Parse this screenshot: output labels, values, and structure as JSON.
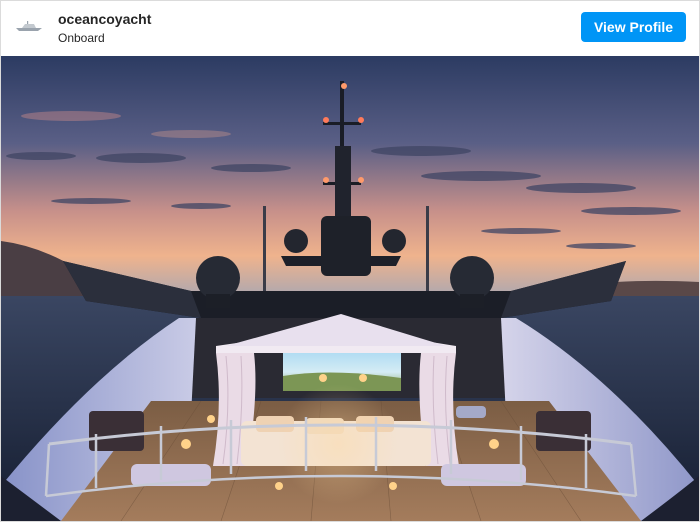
{
  "post": {
    "username": "oceancoyacht",
    "location": "Onboard",
    "view_profile_label": "View Profile",
    "avatar_icon": "yacht-logo-icon"
  },
  "photo": {
    "alt": "Yacht deck with outdoor cinema cabana at dusk"
  },
  "colors": {
    "accent": "#0095f6",
    "sky_top": "#2e3f66",
    "sky_horizon": "#e8a98a",
    "sea": "#1f2b44"
  }
}
